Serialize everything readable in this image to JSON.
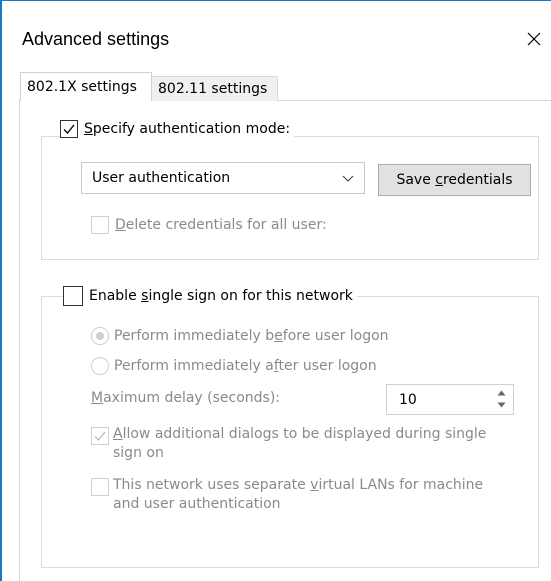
{
  "window": {
    "title": "Advanced settings"
  },
  "tabs": [
    {
      "label": "802.1X settings",
      "active": true
    },
    {
      "label": "802.11 settings",
      "active": false
    }
  ],
  "auth_group": {
    "specify_mode_label_pre": "",
    "specify_mode_label_u": "S",
    "specify_mode_label_post": "pecify authentication mode:",
    "specify_mode_checked": true,
    "dropdown_value": "User authentication",
    "save_button_pre": "Save ",
    "save_button_u": "c",
    "save_button_post": "redentials",
    "delete_pre": "",
    "delete_u": "D",
    "delete_post": "elete credentials for all user:"
  },
  "sso_group": {
    "enable_pre": "Enable ",
    "enable_u": "s",
    "enable_post": "ingle sign on for this network",
    "enable_checked": false,
    "radio_before_pre": "Perform immediately b",
    "radio_before_u": "e",
    "radio_before_post": "fore user logon",
    "radio_after_pre": "Perform immediately a",
    "radio_after_u": "f",
    "radio_after_post": "ter user logon",
    "delay_pre": "",
    "delay_u": "M",
    "delay_post": "aximum delay (seconds):",
    "delay_value": "10",
    "allow_pre": "",
    "allow_u": "A",
    "allow_post": "llow additional dialogs to be displayed during single",
    "allow_line2": "sign on",
    "allow_checked": true,
    "vlan_pre": "This network uses separate ",
    "vlan_u": "v",
    "vlan_post": "irtual LANs for machine",
    "vlan_line2": "and user authentication",
    "vlan_checked": false
  },
  "colors": {
    "accent": "#1a78c2",
    "disabled_text": "#8a8a8a"
  }
}
